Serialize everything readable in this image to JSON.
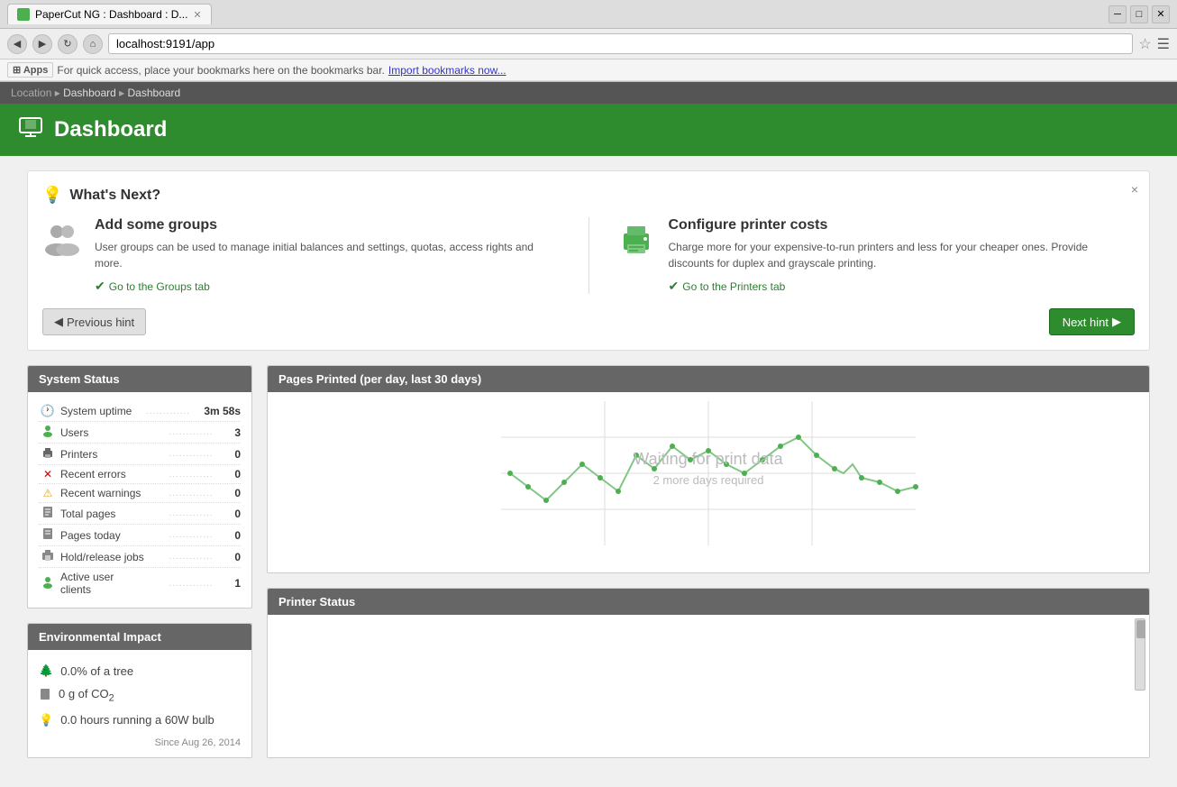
{
  "browser": {
    "tab_title": "PaperCut NG : Dashboard : D...",
    "url": "localhost:9191/app",
    "bookmarks_text": "For quick access, place your bookmarks here on the bookmarks bar.",
    "import_bookmarks": "Import bookmarks now..."
  },
  "breadcrumb": {
    "label": "Location",
    "items": [
      "Dashboard",
      "Dashboard"
    ]
  },
  "header": {
    "title": "Dashboard",
    "icon": "🖥"
  },
  "whats_next": {
    "title": "What's Next?",
    "close_label": "×",
    "hints": [
      {
        "heading": "Add some groups",
        "description": "User groups can be used to manage initial balances and settings, quotas, access rights and more.",
        "link_text": "Go to the Groups tab"
      },
      {
        "heading": "Configure printer costs",
        "description": "Charge more for your expensive-to-run printers and less for your cheaper ones. Provide discounts for duplex and grayscale printing.",
        "link_text": "Go to the Printers tab"
      }
    ],
    "prev_label": "Previous hint",
    "next_label": "Next hint"
  },
  "system_status": {
    "header": "System Status",
    "rows": [
      {
        "label": "System uptime",
        "value": "3m 58s",
        "icon": "clock"
      },
      {
        "label": "Users",
        "value": "3",
        "icon": "user"
      },
      {
        "label": "Printers",
        "value": "0",
        "icon": "printer"
      },
      {
        "label": "Recent errors",
        "value": "0",
        "icon": "error"
      },
      {
        "label": "Recent warnings",
        "value": "0",
        "icon": "warning"
      },
      {
        "label": "Total pages",
        "value": "0",
        "icon": "pages"
      },
      {
        "label": "Pages today",
        "value": "0",
        "icon": "pages"
      },
      {
        "label": "Hold/release jobs",
        "value": "0",
        "icon": "printer"
      },
      {
        "label": "Active user clients",
        "value": "1",
        "icon": "user"
      }
    ]
  },
  "pages_chart": {
    "header": "Pages Printed (per day, last 30 days)",
    "waiting_text": "Waiting for print data",
    "waiting_sub": "2 more days required"
  },
  "environmental": {
    "header": "Environmental Impact",
    "items": [
      {
        "text": "0.0% of a tree",
        "icon": "🌲"
      },
      {
        "text": "0 g of CO₂",
        "icon": "📄"
      },
      {
        "text": "0.0 hours running a 60W bulb",
        "icon": "💡"
      }
    ],
    "since": "Since Aug 26, 2014"
  },
  "printer_status": {
    "header": "Printer Status"
  }
}
